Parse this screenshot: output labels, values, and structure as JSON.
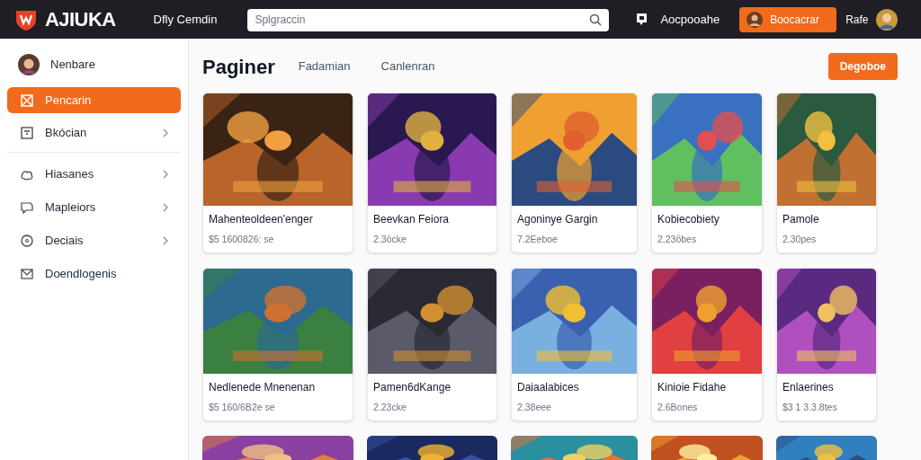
{
  "header": {
    "logo": "AJIUKA",
    "nav_link": "Dfly Cemdin",
    "search": {
      "placeholder": "Splgraccin"
    },
    "link": "Aocpooahe",
    "button": "Boocacrar",
    "user": "Rafe"
  },
  "sidebar": {
    "user": "Nenbare",
    "items": [
      {
        "label": "Pencarin",
        "selected": true,
        "chevron": false
      },
      {
        "label": "Bkócian",
        "selected": false,
        "chevron": true,
        "divider": true
      },
      {
        "label": "Hiasanes",
        "selected": false,
        "chevron": true
      },
      {
        "label": "Mapleiors",
        "selected": false,
        "chevron": true
      },
      {
        "label": "Deciais",
        "selected": false,
        "chevron": true
      },
      {
        "label": "Doendlogenis",
        "selected": false,
        "chevron": false
      }
    ]
  },
  "content": {
    "title": "Paginer",
    "tabs": [
      {
        "label": "Fadamian",
        "selected": false
      },
      {
        "label": "Canlenran",
        "selected": false
      }
    ],
    "button": "Degoboe",
    "cards": [
      {
        "kind": "picture",
        "title": "Mahenteoldeen'enger",
        "meta": "$5 1600826: se"
      },
      {
        "kind": "picture",
        "title": "Beevkan Feiora",
        "meta": "2.3öcke"
      },
      {
        "kind": "picture",
        "title": "Agoninye Gargin",
        "meta": "7.2Eeboe"
      },
      {
        "kind": "picture",
        "title": "Kobiecobiety",
        "meta": "2.23öbes"
      },
      {
        "kind": "picture",
        "title": "Pamole",
        "meta": "2.30pes"
      },
      {
        "kind": "picture",
        "title": "Nedlenede Mnenenan",
        "meta": "$5 160/6B2e se"
      },
      {
        "kind": "picture",
        "title": "Pamen6dKange",
        "meta": "2.23cke"
      },
      {
        "kind": "picture",
        "title": "Daiaalabices",
        "meta": "2.38eee"
      },
      {
        "kind": "picture",
        "title": "Kinioie Fidahe",
        "meta": "2.6Bones"
      },
      {
        "kind": "picture",
        "title": "Enlaerines",
        "meta": "$3 1 3.3.8tes"
      },
      {
        "kind": "picture"
      },
      {
        "kind": "picture"
      },
      {
        "kind": "picture"
      },
      {
        "kind": "picture"
      },
      {
        "kind": "picture"
      }
    ]
  }
}
